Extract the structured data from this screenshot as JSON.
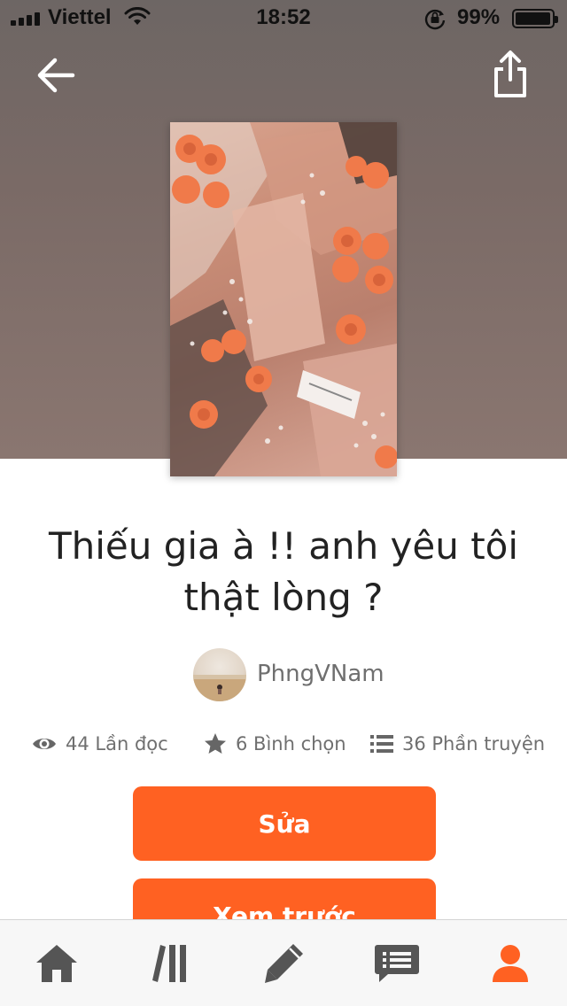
{
  "status_bar": {
    "carrier": "Viettel",
    "time": "18:52",
    "battery_percent": "99%"
  },
  "header": {
    "back_icon": "arrow-left-icon",
    "share_icon": "share-icon"
  },
  "story": {
    "title_line1": "Thiếu gia à !!  anh yêu tôi",
    "title_line2": "thật lòng ?",
    "author": "PhngVNam",
    "stats": {
      "reads": "44 Lần đọc",
      "votes": "6 Bình chọn",
      "parts": "36 Phần truyện"
    }
  },
  "actions": {
    "edit_label": "Sửa",
    "preview_label": "Xem trước"
  },
  "tabbar": {
    "items": [
      {
        "icon": "home-icon",
        "active": false
      },
      {
        "icon": "library-icon",
        "active": false
      },
      {
        "icon": "pencil-icon",
        "active": false
      },
      {
        "icon": "messages-icon",
        "active": false
      },
      {
        "icon": "profile-icon",
        "active": true
      }
    ]
  },
  "colors": {
    "accent": "#ff6122",
    "inactive_icon": "#555555",
    "hero_background": "#786a66"
  }
}
